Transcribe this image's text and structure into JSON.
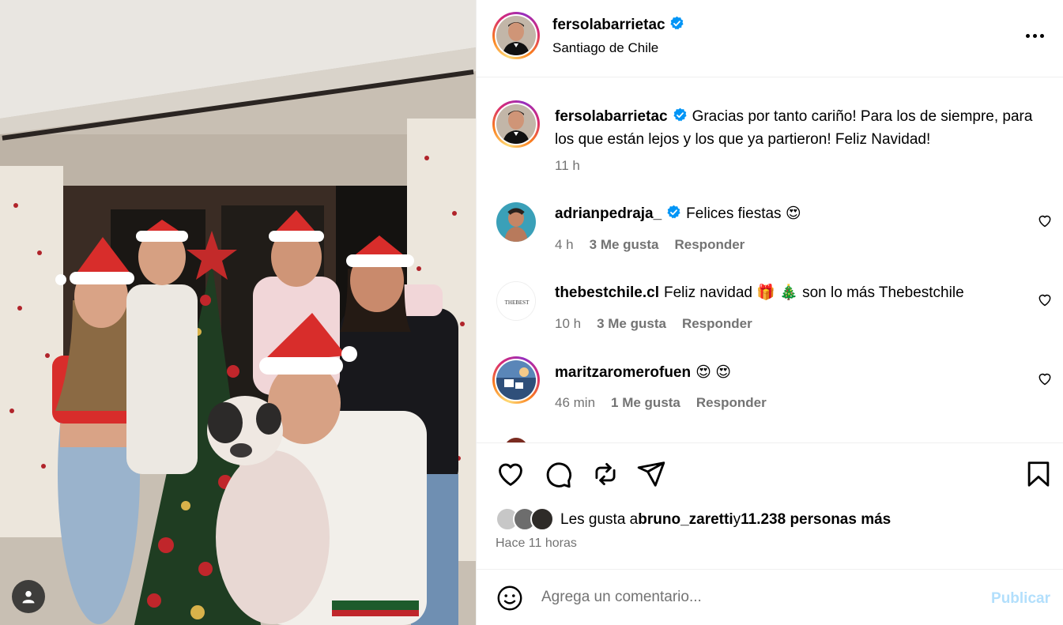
{
  "post": {
    "author": "fersolabarrietac",
    "location": "Santiago de Chile",
    "caption": "Gracias por tanto cariño! Para los de siempre, para los que están lejos y los que ya partieron! Feliz Navidad!",
    "caption_time": "11 h"
  },
  "comments": [
    {
      "user": "adrianpedraja_",
      "verified": true,
      "text": "Felices fiestas 😍",
      "time": "4 h",
      "likes": "3 Me gusta",
      "reply": "Responder"
    },
    {
      "user": "thebestchile.cl",
      "verified": false,
      "text": "Feliz navidad 🎁 🎄 son lo más Thebestchile",
      "time": "10 h",
      "likes": "3 Me gusta",
      "reply": "Responder"
    },
    {
      "user": "maritzaromerofuen",
      "verified": false,
      "text": "😍 😍",
      "time": "46 min",
      "likes": "1 Me gusta",
      "reply": "Responder"
    }
  ],
  "likes_line": {
    "prefix": "Les gusta a ",
    "user": "bruno_zaretti",
    "middle": " y ",
    "count": "11.238 personas más"
  },
  "posted_ago": "Hace 11 horas",
  "composer": {
    "placeholder": "Agrega un comentario...",
    "publish_label": "Publicar"
  },
  "icons": [
    "user-tag-icon",
    "more-options-icon",
    "verified-badge-icon",
    "heart-icon",
    "comment-icon",
    "repost-icon",
    "share-icon",
    "save-bookmark-icon",
    "emoji-icon"
  ],
  "colors": {
    "verified": "#0095f6",
    "muted": "#737373",
    "publish_disabled": "#b2dffc",
    "divider": "#efefef"
  }
}
